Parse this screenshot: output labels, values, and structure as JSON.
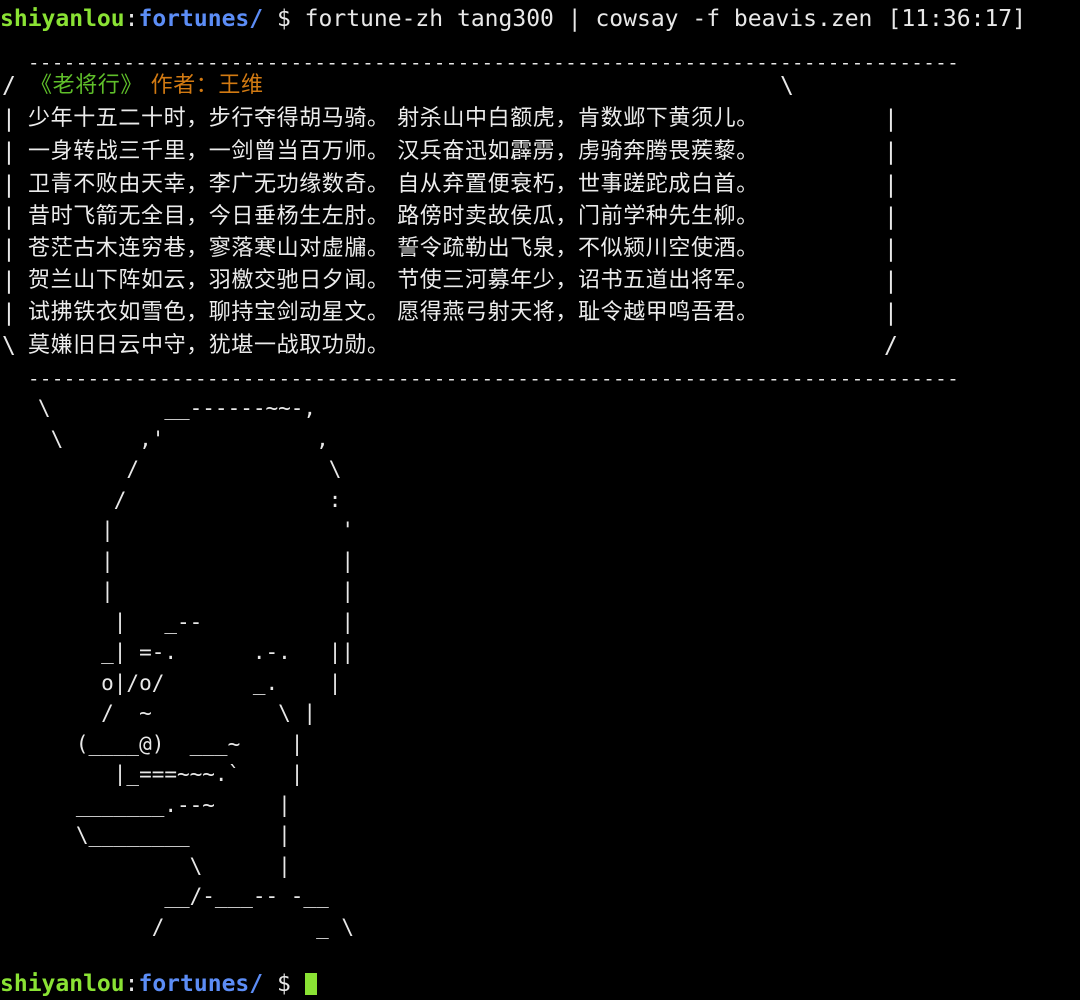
{
  "prompt": {
    "user_host": "shiyanlou",
    "colon": ":",
    "dir": "fortunes/",
    "dollar": " $ ",
    "command": "fortune-zh tang300 | cowsay -f beavis.zen"
  },
  "clock": "[11:36:17]",
  "bubble": {
    "top_border": " ------------------------------------------------------------------------------",
    "bottom_border": " ------------------------------------------------------------------------------",
    "title": "《老将行》",
    "author_label": "作者：王维",
    "left_edges": [
      "/",
      "|",
      "|",
      "|",
      "|",
      "|",
      "|",
      "|",
      "\\"
    ],
    "right_edges": [
      "\\",
      "|",
      "|",
      "|",
      "|",
      "|",
      "|",
      "|",
      "/"
    ],
    "lines": [
      "少年十五二十时，步行夺得胡马骑。 射杀山中白额虎，肯数邺下黄须儿。",
      "一身转战三千里，一剑曾当百万师。 汉兵奋迅如霹雳，虏骑奔腾畏蒺藜。",
      "卫青不败由天幸，李广无功缘数奇。 自从弃置便衰朽，世事蹉跎成白首。",
      "昔时飞箭无全目，今日垂杨生左肘。 路傍时卖故侯瓜，门前学种先生柳。",
      "苍茫古木连穷巷，寥落寒山对虚牖。 誓令疏勒出飞泉，不似颍川空使酒。",
      "贺兰山下阵如云，羽檄交驰日夕闻。 节使三河募年少，诏书五道出将军。",
      "试拂铁衣如雪色，聊持宝剑动星文。 愿得燕弓射天将，耻令越甲鸣吾君。",
      "莫嫌旧日云中守，犹堪一战取功勋。"
    ]
  },
  "ascii_art": "   \\         __------~~-,\n    \\      ,'            ,\n          /               \\\n         /                :\n        |                  '\n        |                  |\n        |                  |\n         |   _--           |\n        _| =-.      .-.   ||\n        o|/o/       _.    |\n        /  ~          \\ |\n      (____@)  ___~    |\n         |_===~~~.`    |\n      _______.--~     |\n      \\________       |\n               \\      |\n             __/-___-- -__\n            /            _ \\",
  "bottom_prompt": {
    "user_host": "shiyanlou",
    "colon": ":",
    "dir": "fortunes/",
    "dollar": " $ "
  }
}
